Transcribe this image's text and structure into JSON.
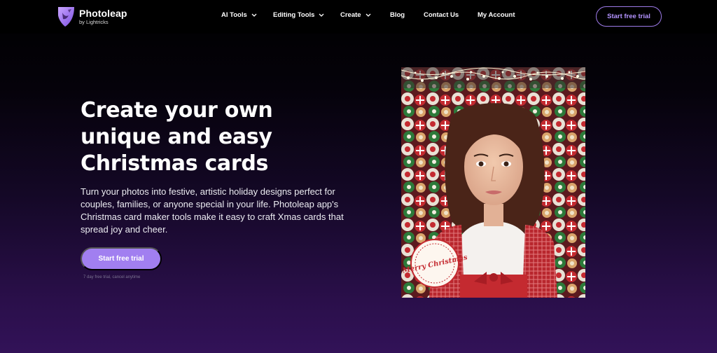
{
  "brand": {
    "name": "Photoleap",
    "byline": "by Lightricks",
    "accent": "#a17ff0",
    "outline_accent": "#9d7ae8"
  },
  "nav": {
    "items": [
      {
        "label": "AI Tools",
        "has_dropdown": true
      },
      {
        "label": "Editing Tools",
        "has_dropdown": true
      },
      {
        "label": "Create",
        "has_dropdown": true
      },
      {
        "label": "Blog",
        "has_dropdown": false
      },
      {
        "label": "Contact Us",
        "has_dropdown": false
      },
      {
        "label": "My Account",
        "has_dropdown": false
      }
    ],
    "cta_label": "Start free trial"
  },
  "hero": {
    "title_lines": [
      "Create your own",
      "unique and easy",
      "Christmas cards"
    ],
    "description": "Turn your photos into festive, artistic holiday designs perfect for couples, families, or anyone special in your life. Photoleap app's Christmas card maker tools make it easy to craft Xmas cards that spread joy and cheer.",
    "cta_label": "Start free trial",
    "cta_note": "7 day free trial, cancel anytime"
  },
  "card": {
    "stamp_text": "Merry Christmas"
  }
}
